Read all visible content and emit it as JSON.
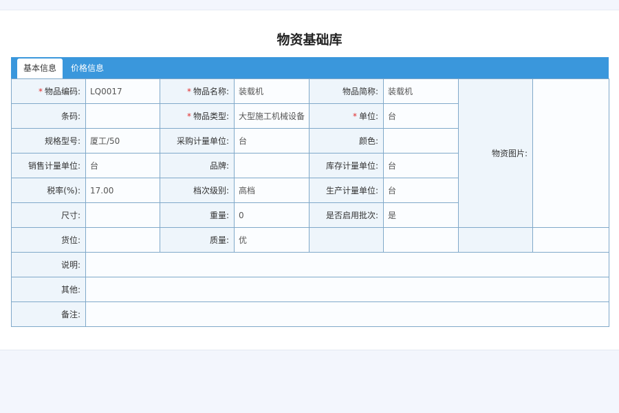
{
  "page": {
    "title": "物资基础库"
  },
  "tabs": [
    {
      "label": "基本信息",
      "active": true
    },
    {
      "label": "价格信息",
      "active": false
    }
  ],
  "required_mark": "*",
  "form": {
    "code": {
      "label": "物品编码:",
      "value": "LQ0017",
      "required": true
    },
    "name": {
      "label": "物品名称:",
      "value": "装载机",
      "required": true
    },
    "short_name": {
      "label": "物品简称:",
      "value": "装载机"
    },
    "image": {
      "label": "物资图片:",
      "value": ""
    },
    "barcode": {
      "label": "条码:",
      "value": ""
    },
    "type": {
      "label": "物品类型:",
      "value": "大型施工机械设备",
      "required": true
    },
    "unit": {
      "label": "单位:",
      "value": "台",
      "required": true
    },
    "spec": {
      "label": "规格型号:",
      "value": "厦工/50"
    },
    "purchase_unit": {
      "label": "采购计量单位:",
      "value": "台"
    },
    "color": {
      "label": "颜色:",
      "value": ""
    },
    "sales_unit": {
      "label": "销售计量单位:",
      "value": "台"
    },
    "brand": {
      "label": "品牌:",
      "value": ""
    },
    "stock_unit": {
      "label": "库存计量单位:",
      "value": "台"
    },
    "tax_rate": {
      "label": "税率(%):",
      "value": "17.00"
    },
    "grade": {
      "label": "档次级别:",
      "value": "高档"
    },
    "production_unit": {
      "label": "生产计量单位:",
      "value": "台"
    },
    "size": {
      "label": "尺寸:",
      "value": ""
    },
    "weight": {
      "label": "重量:",
      "value": "0"
    },
    "batch_enabled": {
      "label": "是否启用批次:",
      "value": "是"
    },
    "location": {
      "label": "货位:",
      "value": ""
    },
    "quality": {
      "label": "质量:",
      "value": "优"
    },
    "description": {
      "label": "说明:",
      "value": ""
    },
    "other": {
      "label": "其他:",
      "value": ""
    },
    "remark": {
      "label": "备注:",
      "value": ""
    }
  },
  "colors": {
    "accent": "#3a97dc",
    "required": "#e02b2b",
    "border": "#7fa8c9",
    "label_bg": "#eef5fb"
  }
}
